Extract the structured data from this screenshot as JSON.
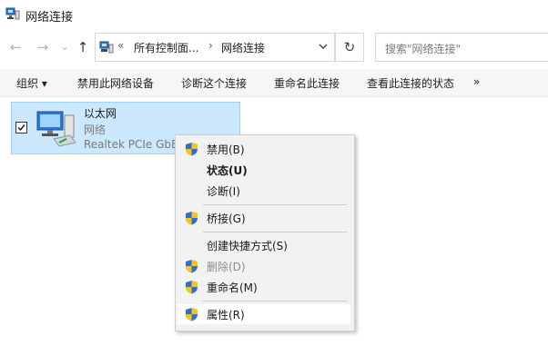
{
  "window": {
    "title": "网络连接",
    "icon": "network-connections-icon"
  },
  "nav": {
    "back_icon": "arrow-left-icon",
    "forward_icon": "arrow-right-icon",
    "recent_icon": "chevron-down-icon",
    "up_icon": "arrow-up-icon",
    "back_glyph": "←",
    "forward_glyph": "→",
    "recent_glyph": "⌄",
    "up_glyph": "↑"
  },
  "address": {
    "overflow": "«",
    "crumbs": [
      "所有控制面...",
      "网络连接"
    ],
    "separator": "›",
    "refresh_glyph": "↻"
  },
  "search": {
    "placeholder": "搜索\"网络连接\""
  },
  "commands": {
    "organize": "组织 ▾",
    "disable": "禁用此网络设备",
    "diagnose": "诊断这个连接",
    "rename": "重命名此连接",
    "status": "查看此连接的状态",
    "more": "»"
  },
  "adapter": {
    "name": "以太网",
    "type": "网络",
    "device": "Realtek PCIe GbE Family Controller",
    "checked": true,
    "selection_color": "#cce8ff"
  },
  "context_menu": {
    "disable": "禁用(B)",
    "status": "状态(U)",
    "diagnose": "诊断(I)",
    "bridge": "桥接(G)",
    "shortcut": "创建快捷方式(S)",
    "delete": "删除(D)",
    "rename": "重命名(M)",
    "properties": "属性(R)"
  },
  "colors": {
    "shield_blue": "#2f6fd0",
    "shield_yellow": "#f5c518",
    "highlight": "#ffffff"
  }
}
